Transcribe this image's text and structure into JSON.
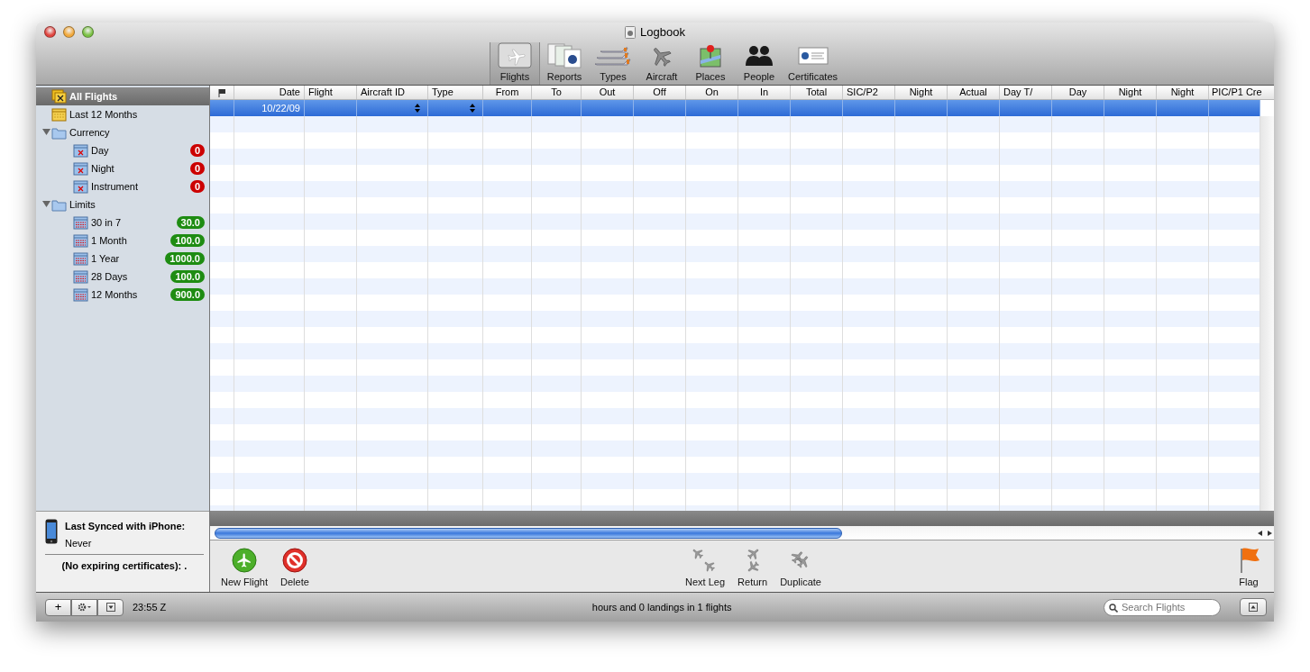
{
  "window": {
    "title": "Logbook"
  },
  "toolbar": [
    {
      "label": "Flights",
      "kind": "flights",
      "selected": true
    },
    {
      "label": "Reports",
      "kind": "reports",
      "selected": false
    },
    {
      "label": "Types",
      "kind": "types",
      "selected": false
    },
    {
      "label": "Aircraft",
      "kind": "aircraft",
      "selected": false
    },
    {
      "label": "Places",
      "kind": "places",
      "selected": false
    },
    {
      "label": "People",
      "kind": "people",
      "selected": false
    },
    {
      "label": "Certificates",
      "kind": "certificates",
      "selected": false
    }
  ],
  "sidebar": {
    "items": [
      {
        "label": "All Flights",
        "kind": "smart",
        "selected": true
      },
      {
        "label": "Last 12 Months",
        "kind": "calendar",
        "selected": false
      },
      {
        "label": "Currency",
        "kind": "folder",
        "selected": false,
        "expanded": true,
        "children": [
          {
            "label": "Day",
            "kind": "currency",
            "selected": false,
            "badge": "0",
            "color": "#cc0000"
          },
          {
            "label": "Night",
            "kind": "currency",
            "selected": false,
            "badge": "0",
            "color": "#cc0000"
          },
          {
            "label": "Instrument",
            "kind": "currency",
            "selected": false,
            "badge": "0",
            "color": "#cc0000"
          }
        ]
      },
      {
        "label": "Limits",
        "kind": "folder",
        "selected": false,
        "expanded": true,
        "children": [
          {
            "label": "30 in 7",
            "kind": "limit",
            "selected": false,
            "badge": "30.0",
            "color": "#1e8c12"
          },
          {
            "label": "1 Month",
            "kind": "limit",
            "selected": false,
            "badge": "100.0",
            "color": "#1e8c12"
          },
          {
            "label": "1 Year",
            "kind": "limit",
            "selected": false,
            "badge": "1000.0",
            "color": "#1e8c12"
          },
          {
            "label": "28 Days",
            "kind": "limit",
            "selected": false,
            "badge": "100.0",
            "color": "#1e8c12"
          },
          {
            "label": "12 Months",
            "kind": "limit",
            "selected": false,
            "badge": "900.0",
            "color": "#1e8c12"
          }
        ]
      }
    ],
    "sync_label": "Last Synced with iPhone:",
    "sync_value": "Never",
    "certificates_note": "(No expiring certificates): ."
  },
  "table": {
    "columns": [
      {
        "kind": "flag"
      },
      {
        "label": "Date",
        "kind": "text"
      },
      {
        "label": "Flight",
        "kind": "text"
      },
      {
        "label": "Aircraft ID",
        "kind": "popup"
      },
      {
        "label": "Type",
        "kind": "popup"
      },
      {
        "label": "From",
        "kind": "text"
      },
      {
        "label": "To",
        "kind": "text"
      },
      {
        "label": "Out",
        "kind": "text"
      },
      {
        "label": "Off",
        "kind": "text"
      },
      {
        "label": "On",
        "kind": "text"
      },
      {
        "label": "In",
        "kind": "text"
      },
      {
        "label": "Total",
        "kind": "text"
      },
      {
        "label": "SIC/P2",
        "kind": "text"
      },
      {
        "label": "Night",
        "kind": "text"
      },
      {
        "label": "Actual",
        "kind": "text"
      },
      {
        "label": "Day T/",
        "kind": "text"
      },
      {
        "label": "Day",
        "kind": "text"
      },
      {
        "label": "Night",
        "kind": "text"
      },
      {
        "label": "Night",
        "kind": "text"
      },
      {
        "label": "PIC/P1 Cre",
        "kind": "text"
      }
    ],
    "rows": [
      {
        "selected": true,
        "cells": [
          "",
          "10/22/09",
          "",
          "",
          "",
          "",
          "",
          "",
          "",
          "",
          "",
          "",
          "",
          "",
          "",
          "",
          "",
          "",
          "",
          ""
        ]
      }
    ]
  },
  "actions": {
    "left": [
      {
        "label": "New Flight",
        "kind": "new"
      },
      {
        "label": "Delete",
        "kind": "delete"
      }
    ],
    "center": [
      {
        "label": "Next Leg",
        "kind": "next-leg"
      },
      {
        "label": "Return",
        "kind": "return"
      },
      {
        "label": "Duplicate",
        "kind": "duplicate"
      }
    ],
    "right": [
      {
        "label": "Flag",
        "kind": "flag"
      }
    ]
  },
  "status_bar": {
    "buttons": [
      {
        "kind": "add",
        "label": "+"
      },
      {
        "kind": "gear"
      },
      {
        "kind": "menu"
      }
    ],
    "time": "23:55 Z",
    "summary": "hours and 0 landings in 1 flights",
    "search": {
      "placeholder": "Search Flights"
    }
  }
}
